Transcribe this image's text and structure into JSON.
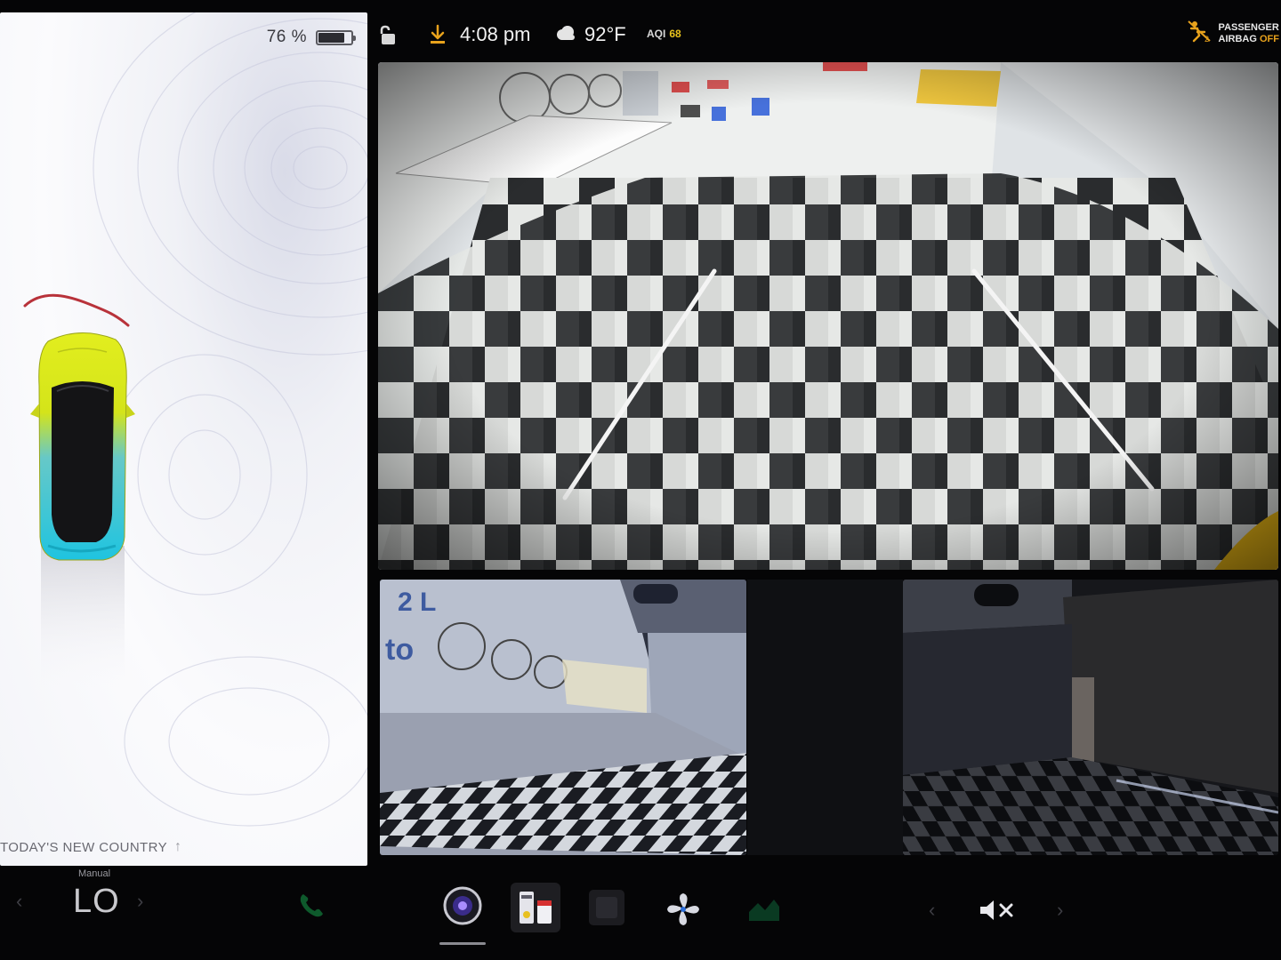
{
  "status": {
    "battery_percent": "76 %",
    "battery_level": 0.76,
    "time": "4:08 pm",
    "temperature": "92°F",
    "aqi_label": "AQI",
    "aqi_value": "68",
    "airbag_line1": "PASSENGER",
    "airbag_line2": "AIRBAG",
    "airbag_state": "OFF"
  },
  "car_panel": {
    "now_playing": "TODAY'S NEW COUNTRY",
    "car_color": "#d9e61a",
    "accent_color": "#26c7d9"
  },
  "climate": {
    "mode": "Manual",
    "temp": "LO"
  },
  "dock": {
    "icons": [
      "phone-icon",
      "camera-icon",
      "toybox-icon",
      "app-icon",
      "fan-icon",
      "media-icon"
    ],
    "active": "camera-icon"
  },
  "volume": {
    "state": "muted"
  },
  "colors": {
    "background": "#050506",
    "panel": "#f5f5f8",
    "download": "#e8a21c",
    "aqi": "#e8c21c"
  }
}
